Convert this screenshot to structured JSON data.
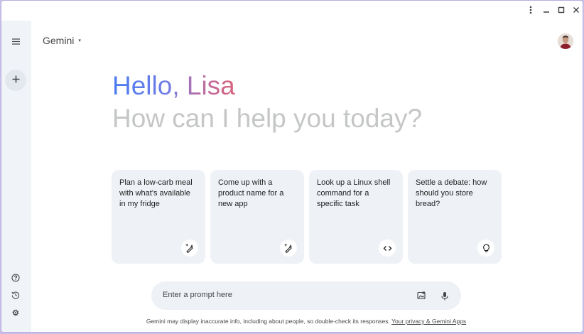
{
  "app": {
    "name": "Gemini",
    "menu_caret": "▾"
  },
  "window_controls": {
    "more_icon": "more-vert-icon",
    "minimize_icon": "minimize-icon",
    "maximize_icon": "maximize-icon",
    "close_icon": "close-icon"
  },
  "sidebar": {
    "menu_icon": "hamburger-menu-icon",
    "new_chat_icon": "plus-icon",
    "help_icon": "help-icon",
    "activity_icon": "history-icon",
    "settings_icon": "gear-icon"
  },
  "greeting": {
    "hello": "Hello, Lisa",
    "subtitle": "How can I help you today?"
  },
  "suggestions": [
    {
      "text": "Plan a low-carb meal with what's available in my fridge",
      "icon": "edit-sparkle-icon"
    },
    {
      "text": "Come up with a product name for a new app",
      "icon": "edit-sparkle-icon"
    },
    {
      "text": "Look up a Linux shell command for a specific task",
      "icon": "code-icon"
    },
    {
      "text": "Settle a debate: how should you store bread?",
      "icon": "lightbulb-icon"
    }
  ],
  "prompt": {
    "placeholder": "Enter a prompt here",
    "image_icon": "image-upload-icon",
    "mic_icon": "mic-icon"
  },
  "footer": {
    "disclaimer": "Gemini may display inaccurate info, including about people, so double-check its responses.",
    "link": "Your privacy & Gemini Apps"
  },
  "colors": {
    "sidebar_bg": "#f0f3f8",
    "card_bg": "#eef1f6",
    "greeting_start": "#4c7df0",
    "greeting_end": "#d9637b",
    "subtitle": "#c4c7c5"
  }
}
